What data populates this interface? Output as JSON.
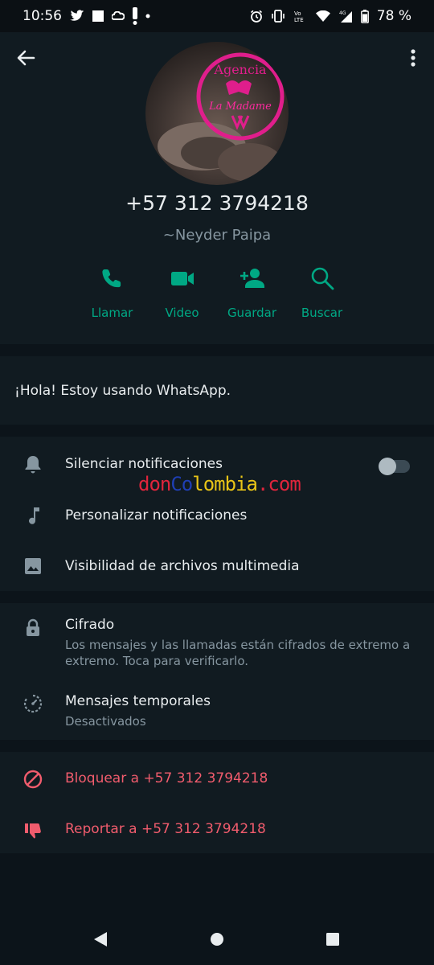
{
  "status_bar": {
    "time": "10:56",
    "battery": "78 %",
    "network_label": "4G"
  },
  "contact": {
    "phone": "+57 312 3794218",
    "push_name": "~Neyder Paipa",
    "avatar_text": [
      "Agencia",
      "La Madame"
    ]
  },
  "actions": [
    {
      "label": "Llamar",
      "icon": "phone-icon"
    },
    {
      "label": "Video",
      "icon": "video-icon"
    },
    {
      "label": "Guardar",
      "icon": "add-person-icon"
    },
    {
      "label": "Buscar",
      "icon": "search-icon"
    }
  ],
  "about": "¡Hola! Estoy usando WhatsApp.",
  "settings": {
    "mute": "Silenciar notificaciones",
    "mute_enabled": false,
    "custom": "Personalizar notificaciones",
    "media": "Visibilidad de archivos multimedia"
  },
  "watermark": {
    "part1": "don",
    "part2": "Co",
    "part3": "lombia",
    "part4": ".com"
  },
  "privacy": {
    "encryption_title": "Cifrado",
    "encryption_sub": "Los mensajes y las llamadas están cifrados de extremo a extremo. Toca para verificarlo.",
    "temp_title": "Mensajes temporales",
    "temp_sub": "Desactivados"
  },
  "danger": {
    "block": "Bloquear a +57 312 3794218",
    "report": "Reportar a +57 312 3794218"
  },
  "colors": {
    "accent": "#00a884",
    "danger": "#f15c6d",
    "background": "#0c141a",
    "panel": "#111b21"
  }
}
